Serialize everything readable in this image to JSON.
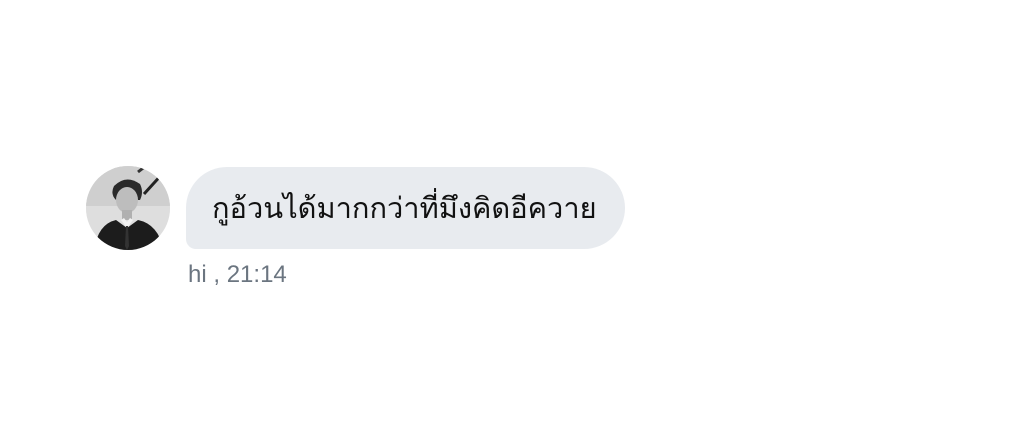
{
  "message": {
    "text": "กูอ้วนได้มากกว่าที่มึงคิดอีควาย",
    "sender": "hi",
    "separator": " ,",
    "time": "21:14"
  },
  "colors": {
    "bubble": "#e8ebef",
    "meta_text": "#6b7580",
    "message_text": "#111111"
  },
  "avatar": {
    "icon": "profile-photo"
  }
}
